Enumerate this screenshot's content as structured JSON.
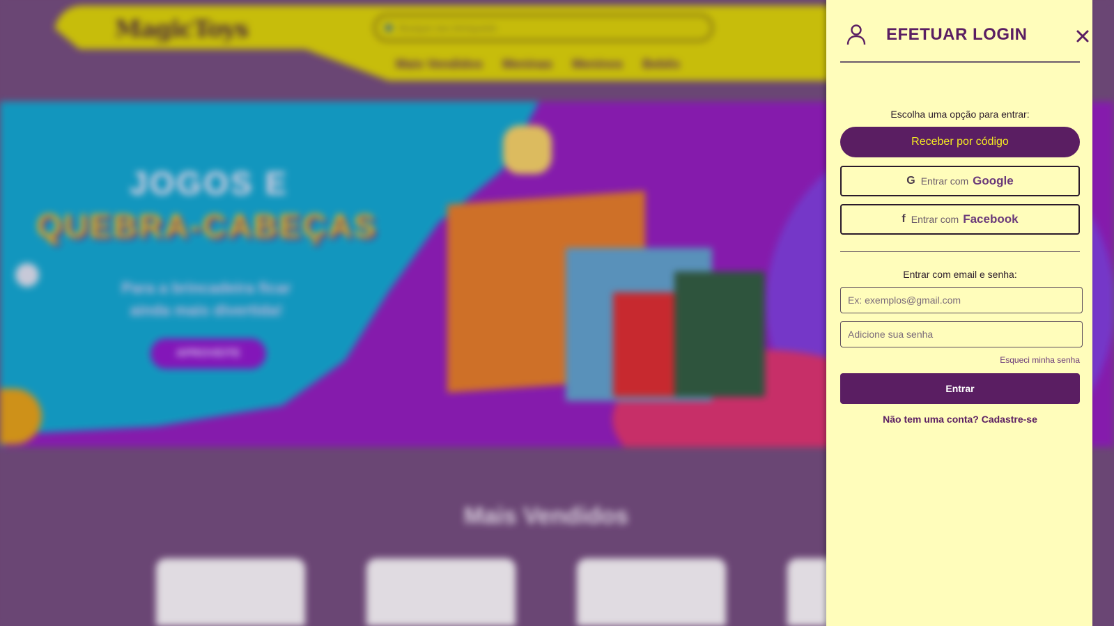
{
  "site": {
    "logo": "MagicToys",
    "search_placeholder": "Busque seu brinquedo",
    "nav": [
      "Mais Vendidos",
      "Meninas",
      "Meninos",
      "Bebês"
    ],
    "hero": {
      "title_line1": "JOGOS E",
      "title_line2": "QUEBRA-CABEÇAS",
      "subtitle": "Para a brincadeira ficar ainda mais divertida!",
      "button": "APROVEITE"
    },
    "section_title": "Mais Vendidos"
  },
  "login": {
    "title": "EFETUAR LOGIN",
    "choose_label": "Escolha uma opção para entrar:",
    "code_button": "Receber por código",
    "google": {
      "prefix": "Entrar com",
      "brand": "Google",
      "icon": "G"
    },
    "facebook": {
      "prefix": "Entrar com",
      "brand": "Facebook",
      "icon": "f"
    },
    "email_label": "Entrar com email e senha:",
    "email_placeholder": "Ex: exemplos@gmail.com",
    "password_placeholder": "Adicione sua senha",
    "forgot": "Esqueci minha senha",
    "submit": "Entrar",
    "signup": "Não tem uma conta? Cadastre-se"
  },
  "colors": {
    "drawer_bg": "#fffdbb",
    "brand_purple": "#5a1e62",
    "code_button_text": "#f6ec22",
    "header_yellow": "#d8d200",
    "page_bg": "#6e4a78"
  }
}
